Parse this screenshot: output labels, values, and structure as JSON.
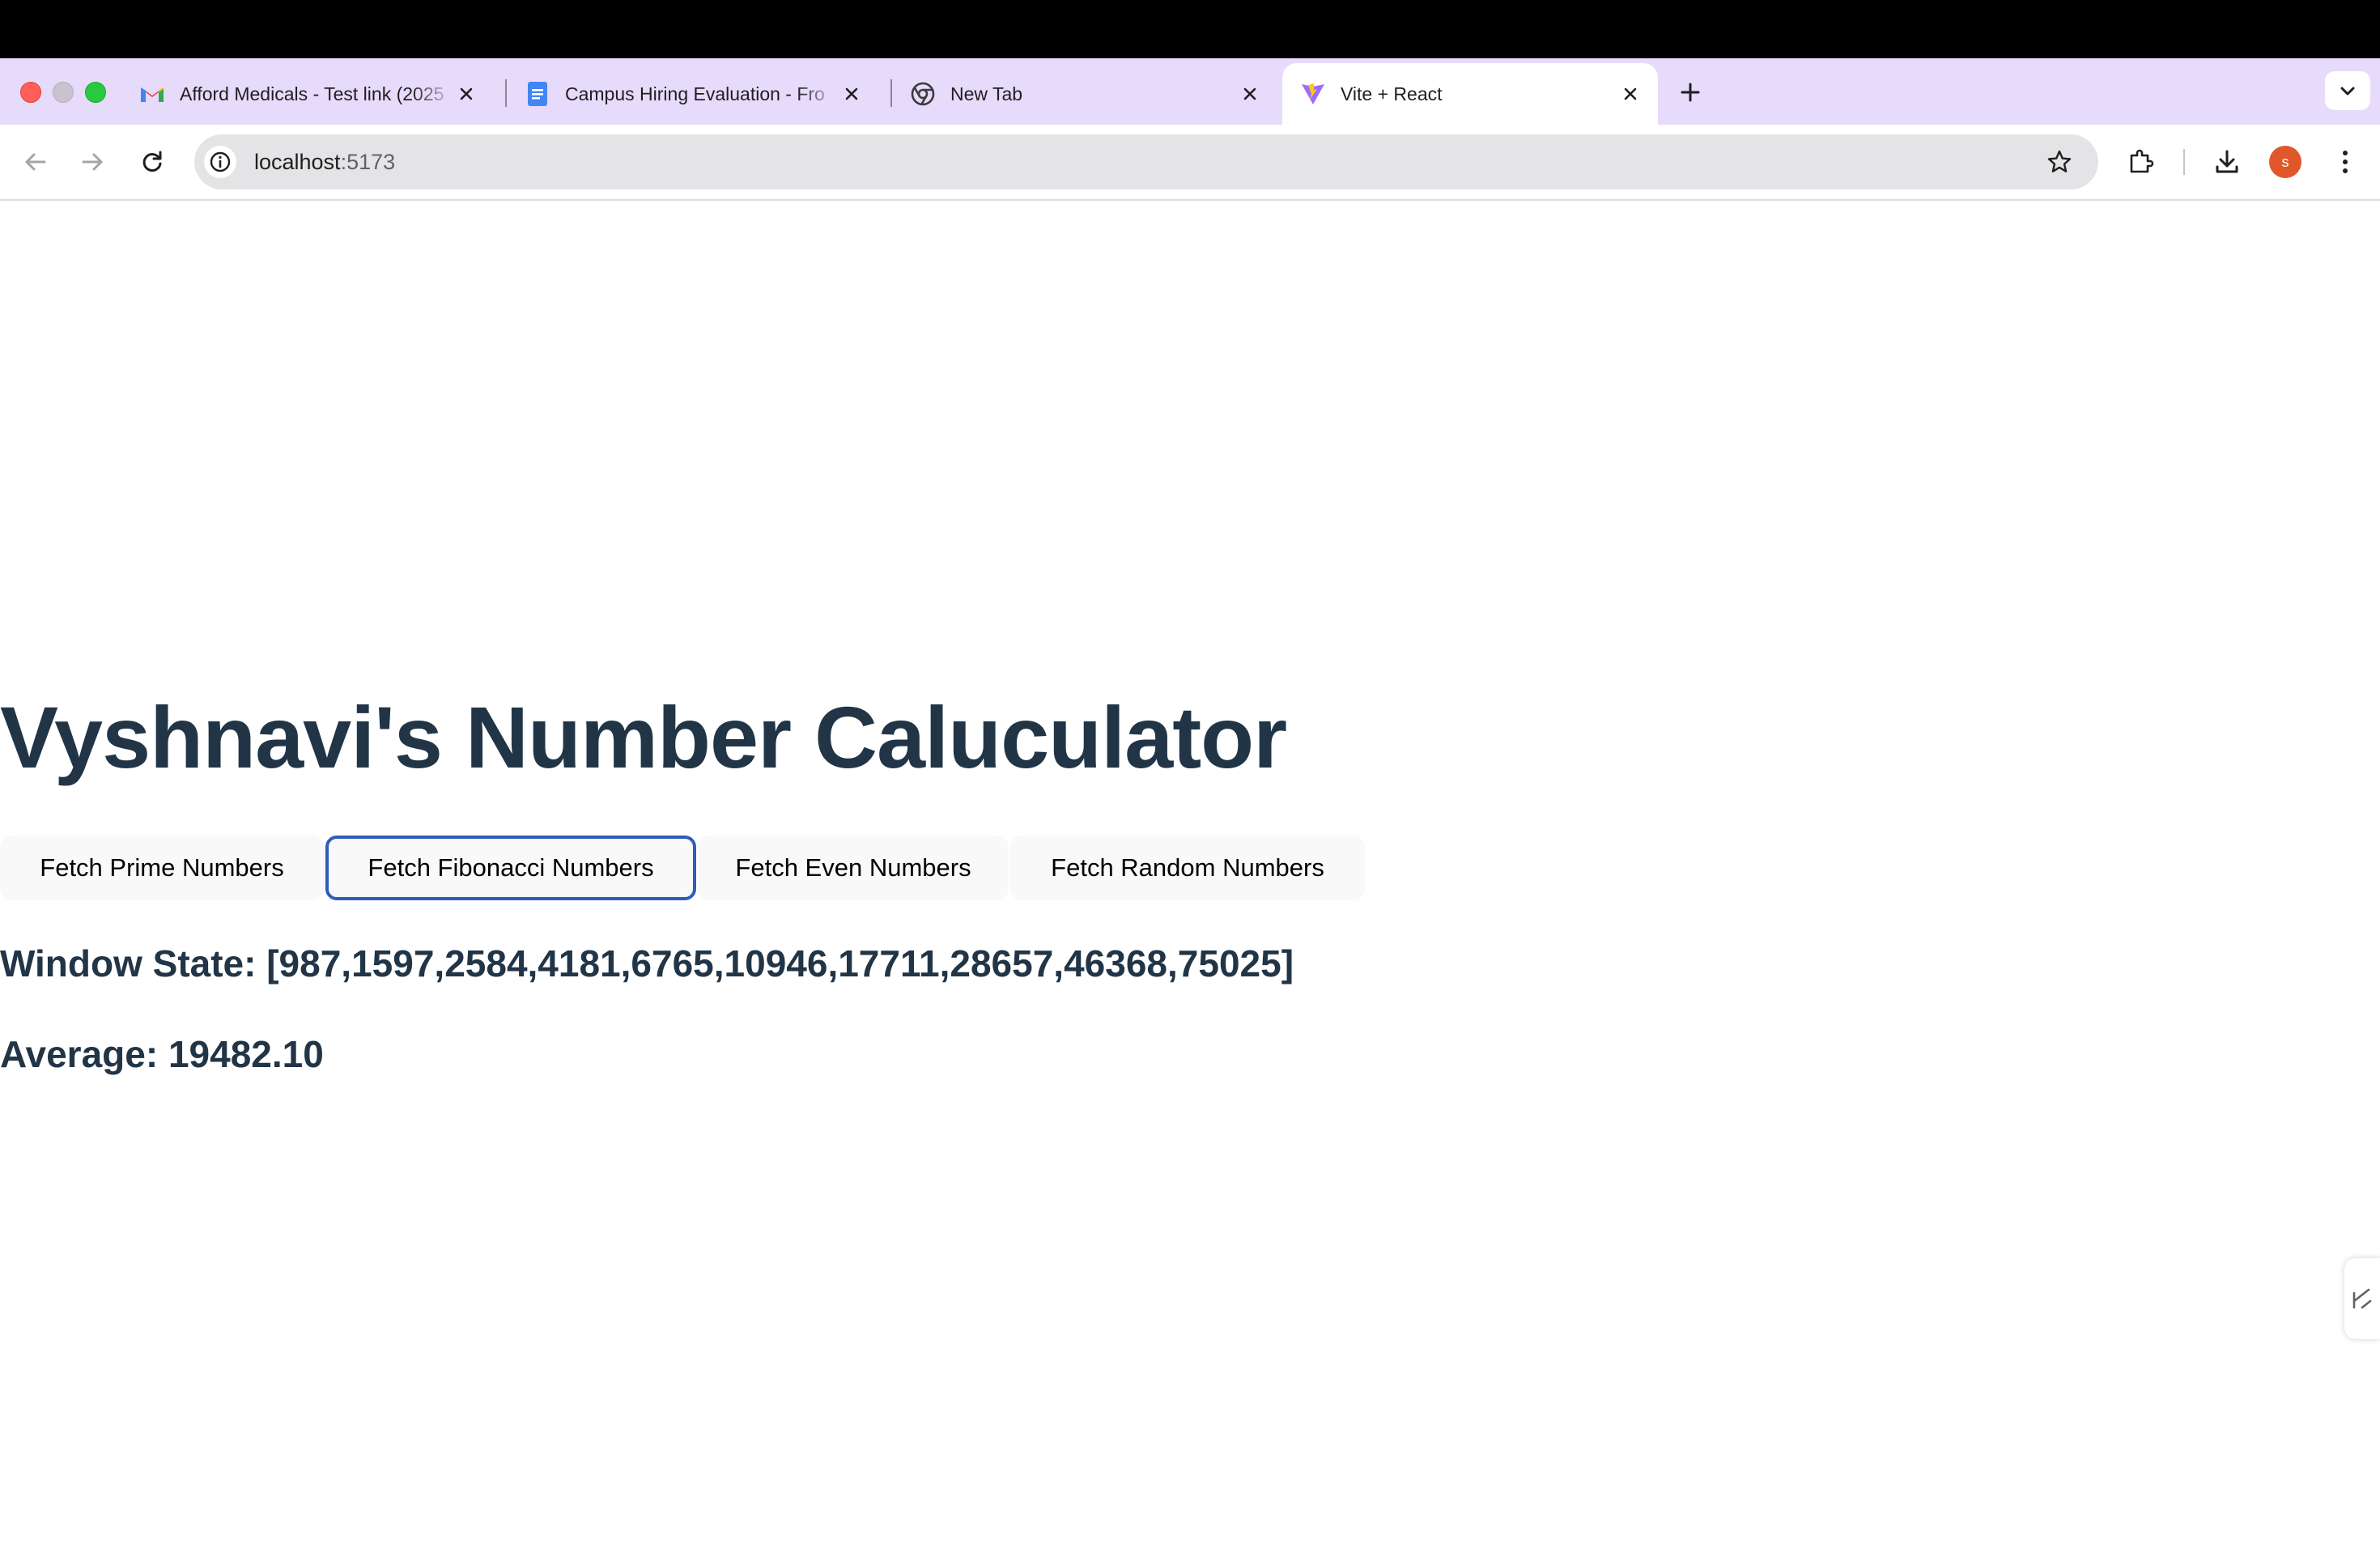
{
  "browser": {
    "tabs": [
      {
        "title": "Afford Medicals - Test link (2025",
        "icon": "gmail-icon",
        "active": false
      },
      {
        "title": "Campus Hiring Evaluation - Fro",
        "icon": "google-docs-icon",
        "active": false
      },
      {
        "title": "New Tab",
        "icon": "chrome-icon",
        "active": false
      },
      {
        "title": "Vite + React",
        "icon": "vite-icon",
        "active": true
      }
    ],
    "address_bar": {
      "host": "localhost",
      "port": ":5173"
    },
    "profile_initial": "s",
    "colors": {
      "tabstrip": "#e6dbfb",
      "avatar": "#e0582a"
    }
  },
  "page": {
    "title": "Vyshnavi's Number Caluculator",
    "buttons": [
      {
        "label": "Fetch Prime Numbers",
        "focused": false
      },
      {
        "label": "Fetch Fibonacci Numbers",
        "focused": true
      },
      {
        "label": "Fetch Even Numbers",
        "focused": false
      },
      {
        "label": "Fetch Random Numbers",
        "focused": false
      }
    ],
    "window_state_text": "Window State: [987,1597,2584,4181,6765,10946,17711,28657,46368,75025]",
    "average_text": "Average: 19482.10",
    "colors": {
      "heading": "#213547",
      "focus_ring": "#2f5db8",
      "button_bg": "#f9f9f9"
    }
  }
}
